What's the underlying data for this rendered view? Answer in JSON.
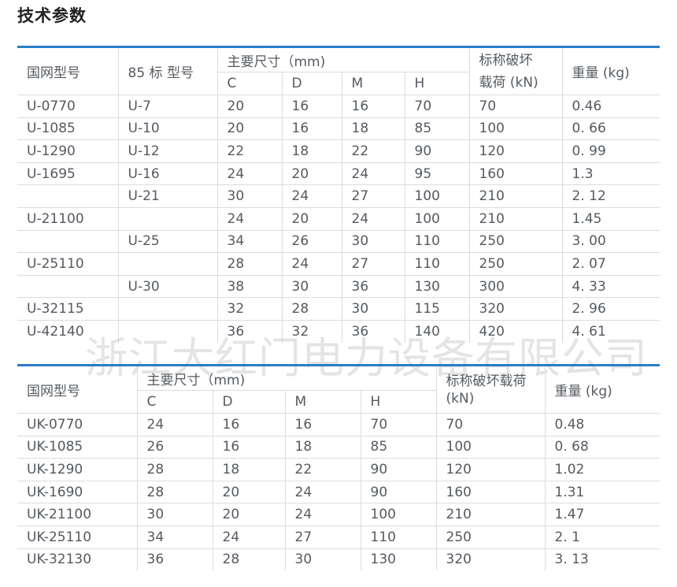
{
  "title": "技术参数",
  "watermark": "浙江大红门电力设备有限公司",
  "table1": {
    "headers": {
      "model": "国网型号",
      "model85": "85 标 型号",
      "dims": "主要尺寸（mm)",
      "C": "C",
      "D": "D",
      "M": "M",
      "H": "H",
      "load_line1": "标称破坏",
      "load_line2": "载荷 (kN)",
      "weight": "重量 (kg)"
    },
    "rows": [
      {
        "model": "U-0770",
        "model85": "U-7",
        "C": "20",
        "D": "16",
        "M": "16",
        "H": "70",
        "load": "70",
        "weight": "0.46"
      },
      {
        "model": "U-1085",
        "model85": "U-10",
        "C": "20",
        "D": "16",
        "M": "18",
        "H": "85",
        "load": "100",
        "weight": "0. 66"
      },
      {
        "model": "U-1290",
        "model85": "U-12",
        "C": "22",
        "D": "18",
        "M": "22",
        "H": "90",
        "load": "120",
        "weight": "0. 99"
      },
      {
        "model": "U-1695",
        "model85": "U-16",
        "C": "24",
        "D": "20",
        "M": "24",
        "H": "95",
        "load": "160",
        "weight": "1.3"
      },
      {
        "model": "",
        "model85": "U-21",
        "C": "30",
        "D": "24",
        "M": "27",
        "H": "100",
        "load": "210",
        "weight": "2. 12"
      },
      {
        "model": "U-21100",
        "model85": "",
        "C": "24",
        "D": "20",
        "M": "24",
        "H": "100",
        "load": "210",
        "weight": "1.45"
      },
      {
        "model": "",
        "model85": "U-25",
        "C": "34",
        "D": "26",
        "M": "30",
        "H": "110",
        "load": "250",
        "weight": "3. 00"
      },
      {
        "model": "U-25110",
        "model85": "",
        "C": "28",
        "D": "24",
        "M": "27",
        "H": "110",
        "load": "250",
        "weight": "2. 07"
      },
      {
        "model": "",
        "model85": "U-30",
        "C": "38",
        "D": "30",
        "M": "36",
        "H": "130",
        "load": "300",
        "weight": "4. 33"
      },
      {
        "model": "U-32115",
        "model85": "",
        "C": "32",
        "D": "28",
        "M": "30",
        "H": "115",
        "load": "320",
        "weight": "2. 96"
      },
      {
        "model": "U-42140",
        "model85": "",
        "C": "36",
        "D": "32",
        "M": "36",
        "H": "140",
        "load": "420",
        "weight": "4. 61"
      }
    ]
  },
  "table2": {
    "headers": {
      "model": "国网型号",
      "dims": "主要尺寸（mm)",
      "C": "C",
      "D": "D",
      "M": "M",
      "H": "H",
      "load_line1": "标称破坏载荷",
      "load_line2": "(kN)",
      "weight": "重量 (kg)"
    },
    "rows": [
      {
        "model": "UK-0770",
        "C": "24",
        "D": "16",
        "M": "16",
        "H": "70",
        "load": "70",
        "weight": "0.48"
      },
      {
        "model": "UK-1085",
        "C": "26",
        "D": "16",
        "M": "18",
        "H": "85",
        "load": "100",
        "weight": "0. 68"
      },
      {
        "model": "UK-1290",
        "C": "28",
        "D": "18",
        "M": "22",
        "H": "90",
        "load": "120",
        "weight": "1.02"
      },
      {
        "model": "UK-1690",
        "C": "28",
        "D": "20",
        "M": "24",
        "H": "90",
        "load": "160",
        "weight": "1.31"
      },
      {
        "model": "UK-21100",
        "C": "30",
        "D": "20",
        "M": "24",
        "H": "100",
        "load": "210",
        "weight": "1.47"
      },
      {
        "model": "UK-25110",
        "C": "34",
        "D": "24",
        "M": "27",
        "H": "110",
        "load": "250",
        "weight": "2. 1"
      },
      {
        "model": "UK-32130",
        "C": "36",
        "D": "28",
        "M": "30",
        "H": "130",
        "load": "320",
        "weight": "3. 13"
      }
    ]
  }
}
